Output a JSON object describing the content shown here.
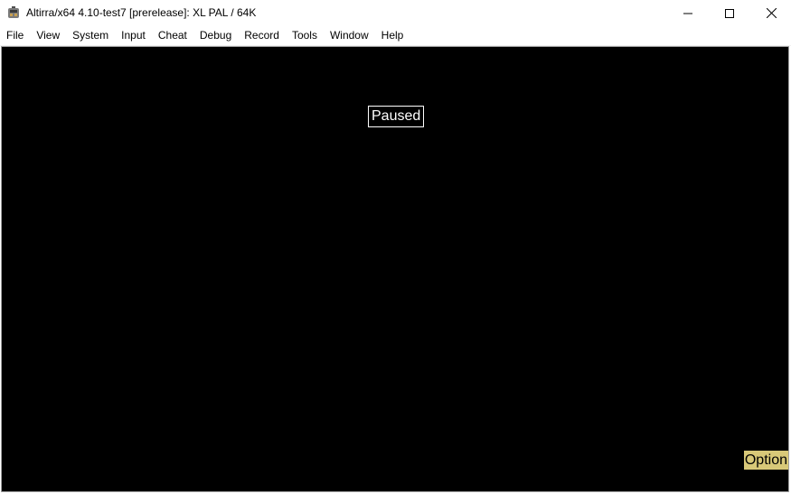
{
  "window": {
    "title": "Altirra/x64 4.10-test7 [prerelease]: XL PAL / 64K",
    "icon": "altirra-app-icon",
    "caption_buttons": {
      "minimize": "minimize-icon",
      "maximize": "maximize-icon",
      "close": "close-icon"
    }
  },
  "menu": {
    "items": [
      "File",
      "View",
      "System",
      "Input",
      "Cheat",
      "Debug",
      "Record",
      "Tools",
      "Window",
      "Help"
    ]
  },
  "display": {
    "background": "#000000",
    "paused_label": "Paused",
    "console_indicator": "Option",
    "console_indicator_color": "#d8c878"
  }
}
